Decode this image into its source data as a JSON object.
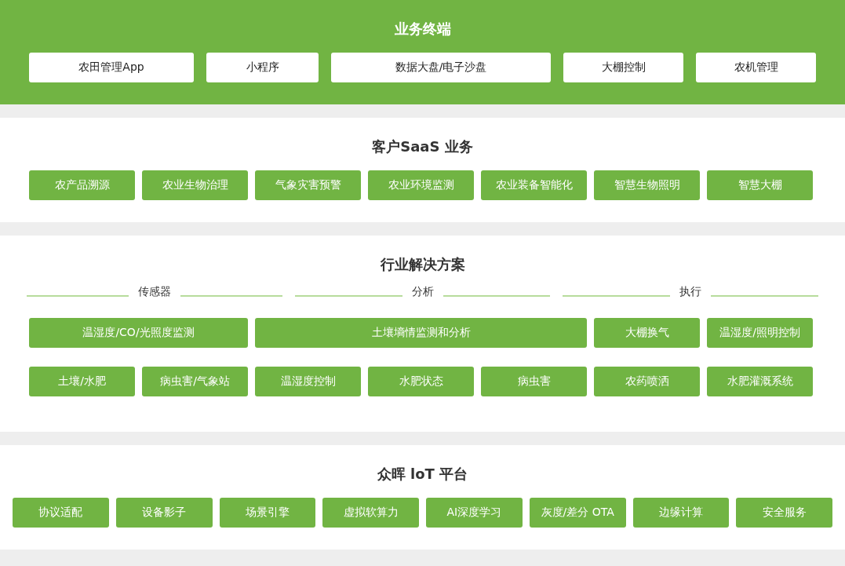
{
  "sections": [
    {
      "kind": "terminal",
      "title": "业务终端",
      "items": [
        "农田管理App",
        "小程序",
        "数据大盘/电子沙盘",
        "大棚控制",
        "农机管理"
      ]
    },
    {
      "kind": "saas",
      "title": "客户SaaS 业务",
      "items": [
        "农产品溯源",
        "农业生物治理",
        "气象灾害预警",
        "农业环境监测",
        "农业装备智能化",
        "智慧生物照明",
        "智慧大棚"
      ]
    },
    {
      "kind": "solution",
      "title": "行业解决方案",
      "groups": [
        "传感器",
        "分析",
        "执行"
      ],
      "rows": [
        {
          "blocks": [
            "温湿度/CO/光照度监测",
            "土壤墒情监测和分析",
            "大棚换气",
            "温湿度/照明控制"
          ]
        },
        {
          "blocks": [
            "土壤/水肥",
            "病虫害/气象站",
            "温湿度控制",
            "水肥状态",
            "病虫害",
            "农药喷洒",
            "水肥灌溉系统"
          ]
        }
      ]
    },
    {
      "kind": "platform",
      "title": "众晖 loT 平台",
      "items": [
        "协议适配",
        "设备影子",
        "场景引擎",
        "虚拟软算力",
        "AI深度学习",
        "灰度/差分 OTA",
        "边缘计算",
        "安全服务"
      ]
    }
  ]
}
